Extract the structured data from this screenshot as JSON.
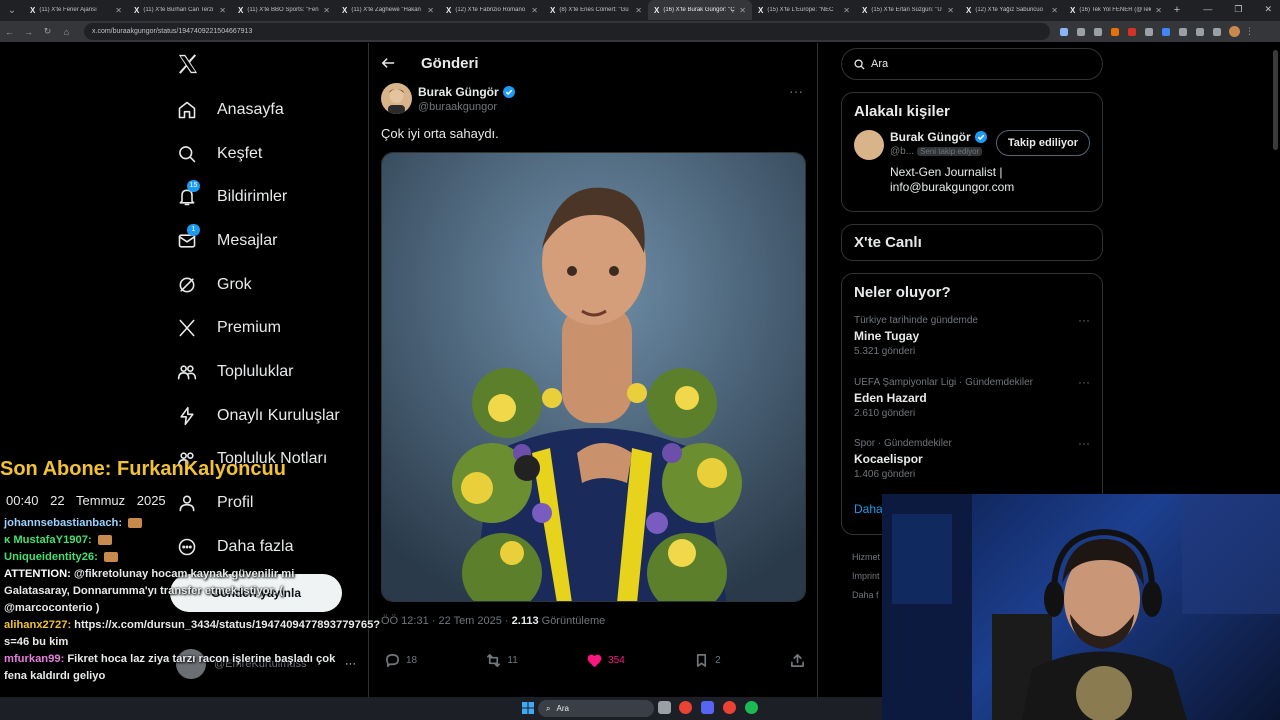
{
  "browser": {
    "tabs": [
      {
        "title": "(11) X'te Fener Ajansı"
      },
      {
        "title": "(11) X'te Burhan Can Terzi"
      },
      {
        "title": "(11) X'te BBO Sports: \"Fen"
      },
      {
        "title": "(11) X'te Zaghewe \"Hakan"
      },
      {
        "title": "(12) X'te Fabrizio Romano"
      },
      {
        "title": "(8) X'te Enes Cömert: \"Gü"
      },
      {
        "title": "(16) X'te Burak Güngör: \"Ç",
        "active": true
      },
      {
        "title": "(15) X'te L'Europe: \"NEC"
      },
      {
        "title": "(15) X'te Ertan Süzgün: \"Ü"
      },
      {
        "title": "(12) X'te Yağız Sabuncuo"
      },
      {
        "title": "(16) Tek Yol FENER (@Tek"
      }
    ],
    "url": "x.com/buraakgungor/status/1947409221504667913"
  },
  "nav": {
    "items": [
      {
        "label": "Anasayfa",
        "icon": "home-icon"
      },
      {
        "label": "Keşfet",
        "icon": "search-icon"
      },
      {
        "label": "Bildirimler",
        "icon": "bell-icon",
        "badge": "15"
      },
      {
        "label": "Mesajlar",
        "icon": "mail-icon",
        "badge": "1"
      },
      {
        "label": "Grok",
        "icon": "grok-icon"
      },
      {
        "label": "Premium",
        "icon": "x-premium-icon"
      },
      {
        "label": "Topluluklar",
        "icon": "people-icon"
      },
      {
        "label": "Onaylı Kuruluşlar",
        "icon": "lightning-icon"
      },
      {
        "label": "Topluluk Notları",
        "icon": "notes-icon"
      },
      {
        "label": "Profil",
        "icon": "person-icon"
      },
      {
        "label": "Daha fazla",
        "icon": "more-circle-icon"
      }
    ],
    "post_button": "Gönderi yayınla",
    "account_handle": "@EmreKurtulmuss"
  },
  "post": {
    "header_title": "Gönderi",
    "author_name": "Burak Güngör",
    "author_handle": "@buraakgungor",
    "text": "Çok iyi orta sahaydı.",
    "time": "ÖÖ 12:31 · 22 Tem 2025 · ",
    "views_count": "2.113",
    "views_label": " Görüntüleme",
    "replies": "18",
    "reposts": "11",
    "likes": "354",
    "bookmarks": "2"
  },
  "sidebar": {
    "search_placeholder": "Ara",
    "related_title": "Alakalı kişiler",
    "related": {
      "name": "Burak Güngör",
      "handle": "@b...",
      "follows_you": "Seni takip ediyor",
      "follow_label": "Takip ediliyor",
      "bio": "Next-Gen Journalist | info@burakgungor.com"
    },
    "live_title": "X'te Canlı",
    "trends_title": "Neler oluyor?",
    "trends": [
      {
        "category": "Türkiye tarihinde gündemde",
        "name": "Mine Tugay",
        "count": "5.321 gönderi"
      },
      {
        "category": "UEFA Şampiyonlar Ligi · Gündemdekiler",
        "name": "Eden Hazard",
        "count": "2.610 gönderi"
      },
      {
        "category": "Spor · Gündemdekiler",
        "name": "Kocaelispor",
        "count": "1.406 gönderi"
      }
    ],
    "show_more": "Daha",
    "footer": [
      "Hizmet",
      "Imprint",
      "Daha f"
    ]
  },
  "stream": {
    "last_sub": "Son Abone: FurkanKalyoncuu",
    "time": "00:40",
    "date": "22 Temmuz 2025",
    "chat": [
      {
        "user": "johannsebastianbach:",
        "color": "#9ad1ff",
        "msg": ""
      },
      {
        "user": "ᴋ MustafaY1907:",
        "color": "#43e06f",
        "msg": ""
      },
      {
        "user": "Uniqueidentity26:",
        "color": "#43e06f",
        "msg": ""
      },
      {
        "user": "ATTENTION:",
        "color": "#ffffff",
        "msg": "@fikretolunay hocam kaynak güvenilir mi Galatasaray, Donnarumma'yı transfer etmek istiyor. ( @marcoconterio )"
      },
      {
        "user": "alihanx2727:",
        "color": "#f1c232",
        "msg": "https://x.com/dursun_3434/status/1947409477893779765?s=46 bu kim"
      },
      {
        "user": "mfurkan99:",
        "color": "#e77ee0",
        "msg": "Fikret hoca laz ziya tarzı racon işlerine başladı çok fena kaldırdı geliyo"
      }
    ]
  },
  "taskbar": {
    "search": "Ara"
  }
}
